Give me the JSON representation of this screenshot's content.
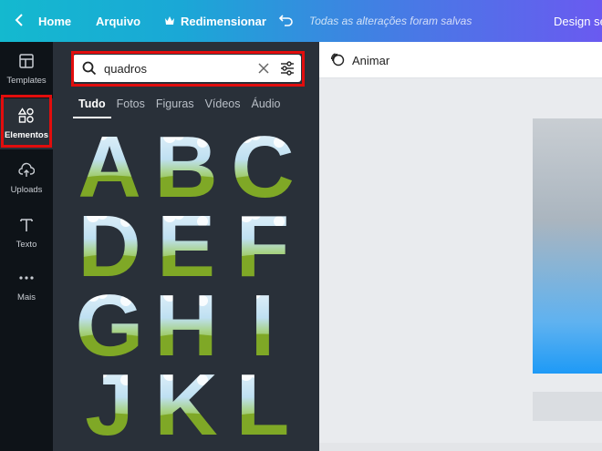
{
  "topbar": {
    "home": "Home",
    "arquivo": "Arquivo",
    "redimensionar": "Redimensionar",
    "saved_status": "Todas as alterações foram salvas",
    "design_cut": "Design se"
  },
  "rail": {
    "items": [
      {
        "label": "Templates",
        "icon": "templates-icon"
      },
      {
        "label": "Elementos",
        "icon": "elements-icon"
      },
      {
        "label": "Uploads",
        "icon": "upload-icon"
      },
      {
        "label": "Texto",
        "icon": "text-icon"
      },
      {
        "label": "Mais",
        "icon": "more-icon"
      }
    ],
    "active": "Elementos"
  },
  "search": {
    "value": "quadros"
  },
  "tabs": [
    "Tudo",
    "Fotos",
    "Figuras",
    "Vídeos",
    "Áudio"
  ],
  "letters": [
    "A",
    "B",
    "C",
    "D",
    "E",
    "F",
    "G",
    "H",
    "I",
    "J",
    "K",
    "L"
  ],
  "toolbar": {
    "animar": "Animar"
  },
  "colors": {
    "highlight": "#e20d0d",
    "rail_bg": "#0e1318",
    "panel_bg": "#293039"
  }
}
